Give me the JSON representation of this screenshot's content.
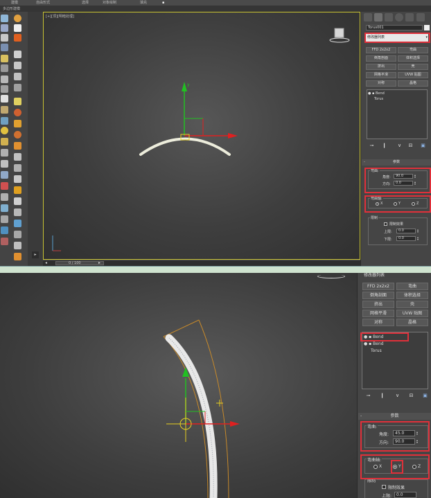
{
  "colors": {
    "accent_red": "#e0303a",
    "viewport_border": "#c9c332",
    "axis_green": "#22c022",
    "axis_red": "#e02020",
    "gizmo_yellow": "#e8d020",
    "bend_orange": "#c88a2a"
  },
  "top": {
    "menu": {
      "items": [
        "建模",
        "自由形式",
        "选择",
        "对象绘制",
        "填充"
      ],
      "sub_label": "多边形建模"
    },
    "viewport_label": "[+][顶][明暗处理]",
    "object_name": "Torus001",
    "modifier_list_label": "修改器列表",
    "modifier_buttons": [
      "FFD 2x2x2",
      "弯曲",
      "倒角剖面",
      "体积选择",
      "挤出",
      "壳",
      "网格平滑",
      "UVW 贴图",
      "对称",
      "晶格"
    ],
    "stack": [
      "Bend",
      "Torus"
    ],
    "stack_icons": [
      "pin-icon",
      "show-end-icon",
      "unique-icon",
      "remove-icon",
      "configure-icon"
    ],
    "params_header": "参数",
    "bend_group": "弯曲:",
    "angle_label": "角度:",
    "angle_value": "90.0",
    "direction_label": "方向:",
    "direction_value": "0.0",
    "axis_group": "弯曲轴:",
    "axis_options": [
      "X",
      "Y",
      "Z"
    ],
    "axis_selected": "X",
    "limit_group": "限制",
    "limit_effect_label": "限制效果",
    "upper_label": "上限:",
    "upper_value": "0.0",
    "lower_label": "下限:",
    "lower_value": "0.0",
    "timeline_label": "0 / 100"
  },
  "bottom": {
    "modifier_list_label": "修改器列表",
    "modifier_buttons": [
      "FFD 2x2x2",
      "弯曲",
      "倒角剖面",
      "体积选择",
      "挤出",
      "壳",
      "网格平滑",
      "UVW 贴图",
      "对称",
      "晶格"
    ],
    "stack": [
      "Bend",
      "Bend",
      "Torus"
    ],
    "params_header": "参数",
    "bend_group": "弯曲:",
    "angle_label": "角度:",
    "angle_value": "45.0",
    "direction_label": "方向:",
    "direction_value": "90.0",
    "axis_group": "弯曲轴:",
    "axis_options": [
      "X",
      "Y",
      "Z"
    ],
    "axis_selected": "Y",
    "limit_group": "限制",
    "limit_effect_label": "限制效果",
    "upper_label": "上限:",
    "upper_value": "0.0"
  }
}
